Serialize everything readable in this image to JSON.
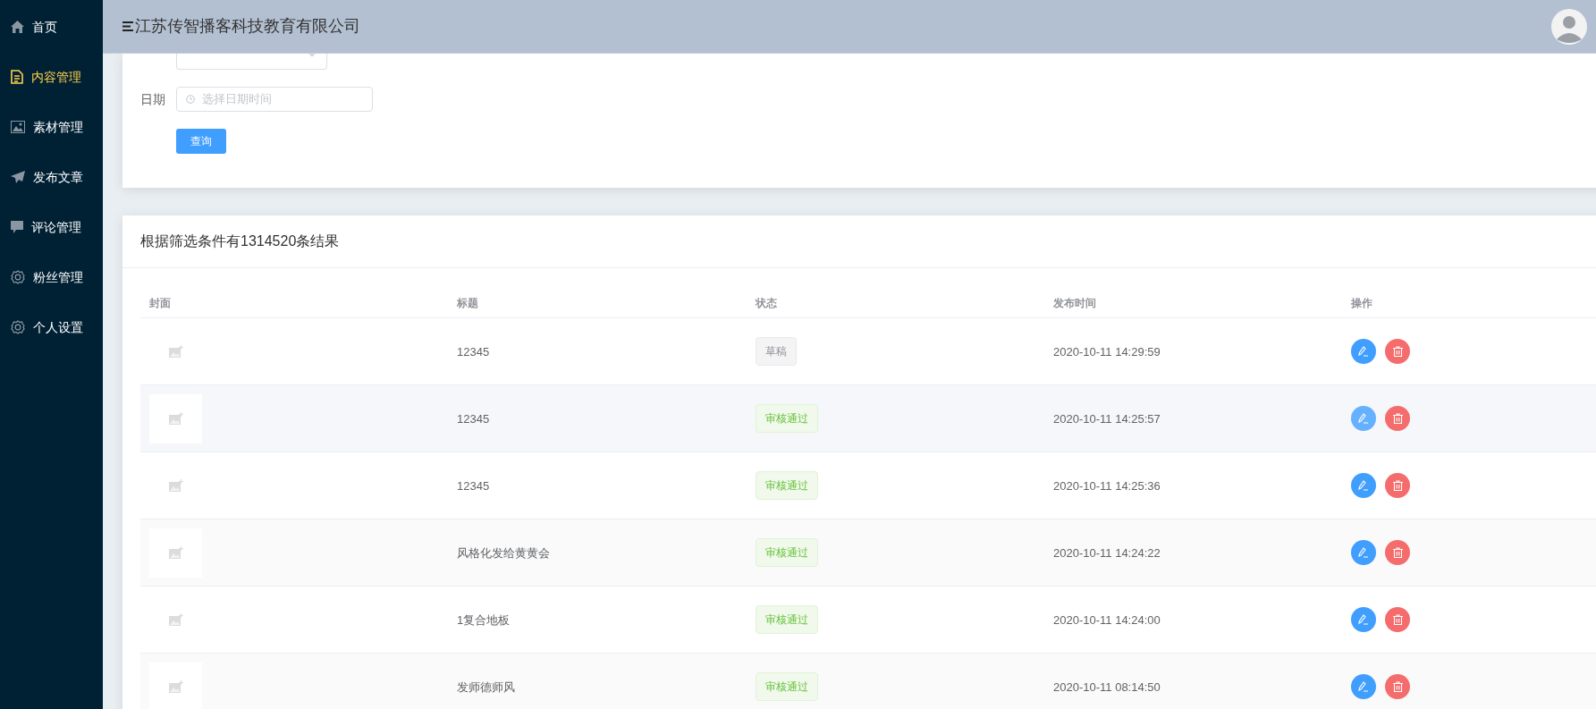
{
  "sidebar": {
    "items": [
      {
        "label": "首页",
        "selected": false
      },
      {
        "label": "内容管理",
        "selected": true
      },
      {
        "label": "素材管理",
        "selected": false
      },
      {
        "label": "发布文章",
        "selected": false
      },
      {
        "label": "评论管理",
        "selected": false
      },
      {
        "label": "粉丝管理",
        "selected": false
      },
      {
        "label": "个人设置",
        "selected": false
      }
    ]
  },
  "header": {
    "title": "江苏传智播客科技教育有限公司"
  },
  "filter": {
    "fields": [
      {
        "label": "日期",
        "kind": "date",
        "placeholder": "选择日期时间"
      }
    ],
    "button": "查询"
  },
  "results": {
    "title": "根据筛选条件有1314520条结果",
    "table": {
      "columns": [
        "封面",
        "标题",
        "状态",
        "发布时间",
        "操作"
      ],
      "rows": [
        {
          "title": "12345",
          "status": {
            "label": "草稿",
            "kind": "draft"
          },
          "time": "2020-10-11 14:29:59",
          "highlighted": false
        },
        {
          "title": "12345",
          "status": {
            "label": "审核通过",
            "kind": "approved"
          },
          "time": "2020-10-11 14:25:57",
          "highlighted": true
        },
        {
          "title": "12345",
          "status": {
            "label": "审核通过",
            "kind": "approved"
          },
          "time": "2020-10-11 14:25:36",
          "highlighted": false
        },
        {
          "title": "风格化发给黄黄会",
          "status": {
            "label": "审核通过",
            "kind": "approved"
          },
          "time": "2020-10-11 14:24:22",
          "highlighted": false
        },
        {
          "title": "1复合地板",
          "status": {
            "label": "审核通过",
            "kind": "approved"
          },
          "time": "2020-10-11 14:24:00",
          "highlighted": false
        },
        {
          "title": "发师德师风",
          "status": {
            "label": "审核通过",
            "kind": "approved"
          },
          "time": "2020-10-11 08:14:50",
          "highlighted": false
        }
      ]
    }
  }
}
